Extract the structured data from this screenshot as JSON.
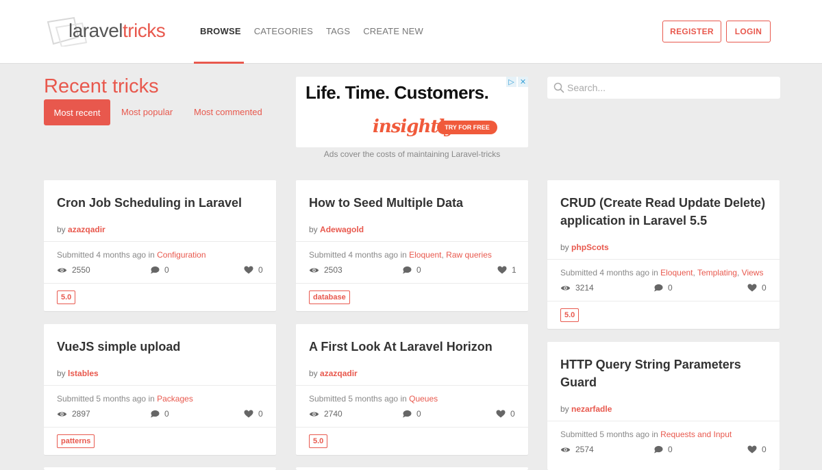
{
  "header": {
    "logo": {
      "part1": "laravel",
      "part2": "tricks"
    },
    "nav": [
      "BROWSE",
      "CATEGORIES",
      "TAGS",
      "CREATE NEW"
    ],
    "register_label": "REGISTER",
    "login_label": "LOGIN"
  },
  "intro": {
    "title": "Recent tricks",
    "filters": [
      "Most recent",
      "Most popular",
      "Most commented"
    ]
  },
  "ad": {
    "headline": "Life. Time. Customers.",
    "brand": "insightly",
    "cta": "TRY FOR FREE",
    "choices": [
      "▷",
      "✕"
    ],
    "caption": "Ads cover the costs of maintaining Laravel-tricks"
  },
  "search": {
    "placeholder": "Search..."
  },
  "card_labels": {
    "by": "by",
    "submitted": "Submitted",
    "in": "in"
  },
  "cards": [
    {
      "title": "Cron Job Scheduling in Laravel",
      "author": "azazqadir",
      "age": "4 months ago",
      "categories": [
        "Configuration"
      ],
      "views": "2550",
      "comments": "0",
      "likes": "0",
      "tag": "5.0"
    },
    {
      "title": "How to Seed Multiple Data",
      "author": "Adewagold",
      "age": "4 months ago",
      "categories": [
        "Eloquent",
        "Raw queries"
      ],
      "views": "2503",
      "comments": "0",
      "likes": "1",
      "tag": "database"
    },
    {
      "title": "CRUD (Create Read Update Delete) application in Laravel 5.5",
      "author": "phpScots",
      "age": "4 months ago",
      "categories": [
        "Eloquent",
        "Templating",
        "Views"
      ],
      "views": "3214",
      "comments": "0",
      "likes": "0",
      "tag": "5.0"
    },
    {
      "title": "VueJS simple upload",
      "author": "lstables",
      "age": "5 months ago",
      "categories": [
        "Packages"
      ],
      "views": "2897",
      "comments": "0",
      "likes": "0",
      "tag": "patterns"
    },
    {
      "title": "A First Look At Laravel Horizon",
      "author": "azazqadir",
      "age": "5 months ago",
      "categories": [
        "Queues"
      ],
      "views": "2740",
      "comments": "0",
      "likes": "0",
      "tag": "5.0"
    },
    {
      "title": "HTTP Query String Parameters Guard",
      "author": "nezarfadle",
      "age": "5 months ago",
      "categories": [
        "Requests and Input"
      ],
      "views": "2574",
      "comments": "0",
      "likes": "0",
      "tag": ""
    }
  ],
  "colors": {
    "accent": "#e8584d",
    "background": "#ececec",
    "ad_brand": "#f05a3b"
  },
  "icons": {
    "views": "eye-icon",
    "comments": "comment-icon",
    "likes": "heart-icon",
    "search": "search-icon"
  }
}
